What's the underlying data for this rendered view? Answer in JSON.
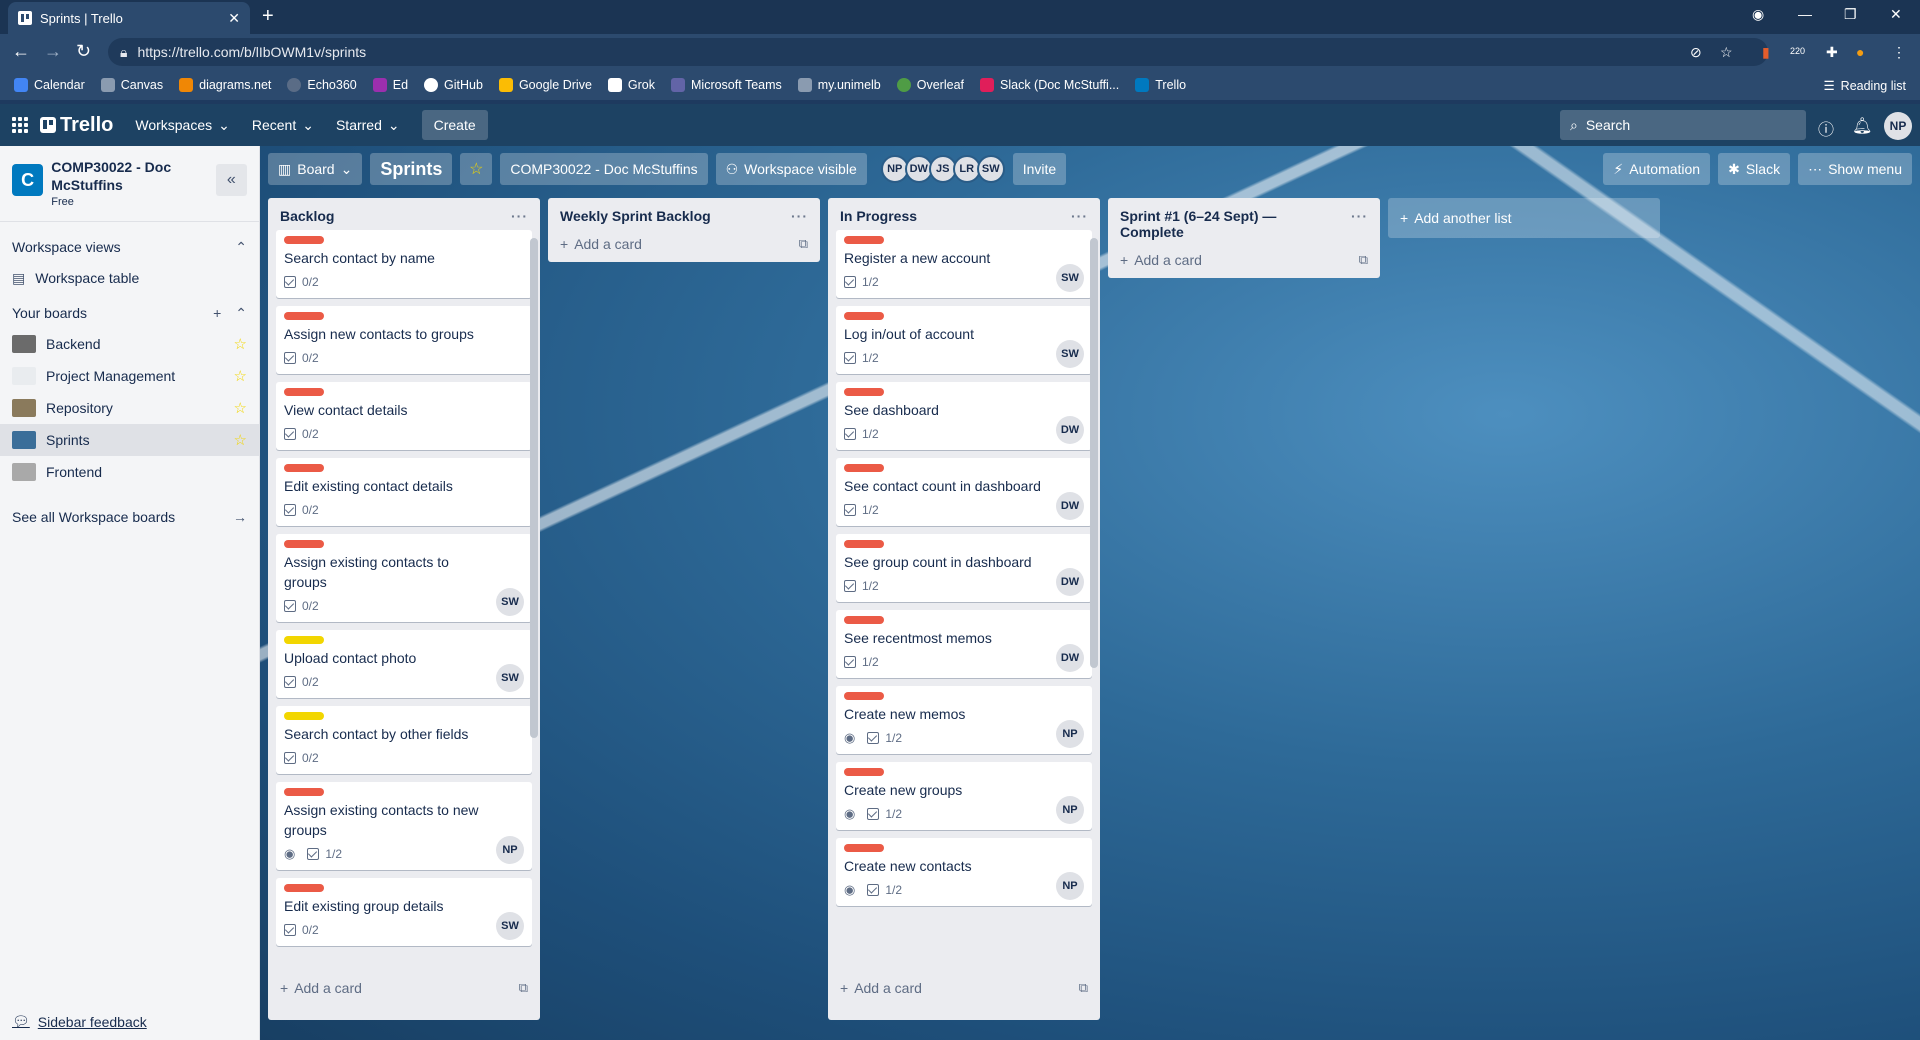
{
  "browser": {
    "tab_title": "Sprints | Trello",
    "url": "https://trello.com/b/lIbOWM1v/sprints",
    "bookmarks": [
      "Calendar",
      "Canvas",
      "diagrams.net",
      "Echo360",
      "Ed",
      "GitHub",
      "Google Drive",
      "Grok",
      "Microsoft Teams",
      "my.unimelb",
      "Overleaf",
      "Slack (Doc McStuffi...",
      "Trello"
    ],
    "reading_list": "Reading list",
    "ext_badge": "220"
  },
  "header": {
    "logo": "Trello",
    "menus": [
      "Workspaces",
      "Recent",
      "Starred"
    ],
    "create": "Create",
    "search_placeholder": "Search",
    "avatar": "NP"
  },
  "sidebar": {
    "workspace_name": "COMP30022 - Doc McStuffins",
    "workspace_initial": "C",
    "plan": "Free",
    "views_title": "Workspace views",
    "workspace_table": "Workspace table",
    "boards_title": "Your boards",
    "boards": [
      {
        "name": "Backend",
        "color": "#6b6b6b"
      },
      {
        "name": "Project Management",
        "color": "#e9ecef"
      },
      {
        "name": "Repository",
        "color": "#8a7a5c"
      },
      {
        "name": "Sprints",
        "color": "#3b6e99"
      },
      {
        "name": "Frontend",
        "color": "#a9a9a9"
      }
    ],
    "see_all": "See all Workspace boards",
    "feedback": "Sidebar feedback"
  },
  "board": {
    "view": "Board",
    "title": "Sprints",
    "workspace": "COMP30022 - Doc McStuffins",
    "visibility": "Workspace visible",
    "members": [
      "NP",
      "DW",
      "JS",
      "LR",
      "SW"
    ],
    "invite": "Invite",
    "automation": "Automation",
    "slack": "Slack",
    "show_menu": "Show menu",
    "add_list": "Add another list",
    "add_card": "Add a card"
  },
  "lists": [
    {
      "title": "Backlog",
      "cards": [
        {
          "label": "red",
          "title": "Search contact by name",
          "checklist": "0/2",
          "member": ""
        },
        {
          "label": "red",
          "title": "Assign new contacts to groups",
          "checklist": "0/2",
          "member": ""
        },
        {
          "label": "red",
          "title": "View contact details",
          "checklist": "0/2",
          "member": ""
        },
        {
          "label": "red",
          "title": "Edit existing contact details",
          "checklist": "0/2",
          "member": ""
        },
        {
          "label": "red",
          "title": "Assign existing contacts to groups",
          "checklist": "0/2",
          "member": "SW"
        },
        {
          "label": "yellow",
          "title": "Upload contact photo",
          "checklist": "0/2",
          "member": "SW"
        },
        {
          "label": "yellow",
          "title": "Search contact by other fields",
          "checklist": "0/2",
          "member": ""
        },
        {
          "label": "red",
          "title": "Assign existing contacts to new groups",
          "checklist": "1/2",
          "member": "NP",
          "watch": true
        },
        {
          "label": "red",
          "title": "Edit existing group details",
          "checklist": "0/2",
          "member": "SW"
        }
      ]
    },
    {
      "title": "Weekly Sprint Backlog",
      "cards": []
    },
    {
      "title": "In Progress",
      "cards": [
        {
          "label": "red",
          "title": "Register a new account",
          "checklist": "1/2",
          "member": "SW"
        },
        {
          "label": "red",
          "title": "Log in/out of account",
          "checklist": "1/2",
          "member": "SW"
        },
        {
          "label": "red",
          "title": "See dashboard",
          "checklist": "1/2",
          "member": "DW"
        },
        {
          "label": "red",
          "title": "See contact count in dashboard",
          "checklist": "1/2",
          "member": "DW"
        },
        {
          "label": "red",
          "title": "See group count in dashboard",
          "checklist": "1/2",
          "member": "DW"
        },
        {
          "label": "red",
          "title": "See recentmost memos",
          "checklist": "1/2",
          "member": "DW"
        },
        {
          "label": "red",
          "title": "Create new memos",
          "checklist": "1/2",
          "member": "NP",
          "watch": true
        },
        {
          "label": "red",
          "title": "Create new groups",
          "checklist": "1/2",
          "member": "NP",
          "watch": true
        },
        {
          "label": "red",
          "title": "Create new contacts",
          "checklist": "1/2",
          "member": "NP",
          "watch": true
        }
      ]
    },
    {
      "title": "Sprint #1 (6–24 Sept) — Complete",
      "cards": []
    }
  ]
}
